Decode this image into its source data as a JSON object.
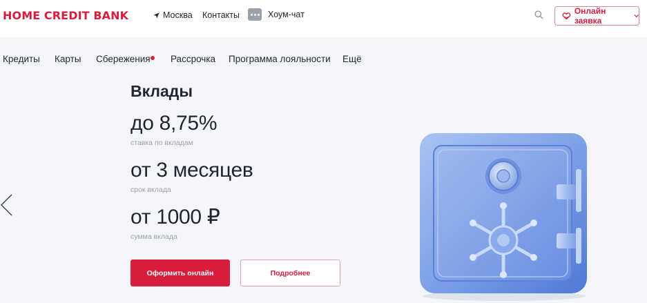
{
  "header": {
    "logo": "HOME CREDIT BANK",
    "city": "Москва",
    "contacts": "Контакты",
    "chat": "Хоум-чат",
    "apply_label": "Онлайн заявка"
  },
  "nav": {
    "items": [
      {
        "label": "Кредиты"
      },
      {
        "label": "Карты"
      },
      {
        "label": "Сбережения"
      },
      {
        "label": "Рассрочка"
      },
      {
        "label": "Программа лояльности"
      },
      {
        "label": "Ещё"
      }
    ]
  },
  "hero": {
    "title": "Вклады",
    "rate": {
      "value": "до 8,75%",
      "caption": "ставка по вкладам"
    },
    "term": {
      "value": "от 3 месяцев",
      "caption": "срок вклада"
    },
    "amount": {
      "value": "от 1000 ₽",
      "caption": "сумма вклада"
    },
    "primary_button": "Оформить онлайн",
    "secondary_button": "Подробнее"
  },
  "colors": {
    "brand": "#d81d3d",
    "background": "#f4f5f9",
    "text": "#1e2633",
    "muted": "#9ba1ab"
  },
  "icons": {
    "location": "location-arrow-icon",
    "chat": "chat-bubble-icon",
    "search": "search-icon",
    "apply": "heart-hands-icon",
    "dropdown": "chevron-down-icon",
    "carousel_prev": "chevron-left-icon",
    "illustration": "safe-illustration"
  }
}
